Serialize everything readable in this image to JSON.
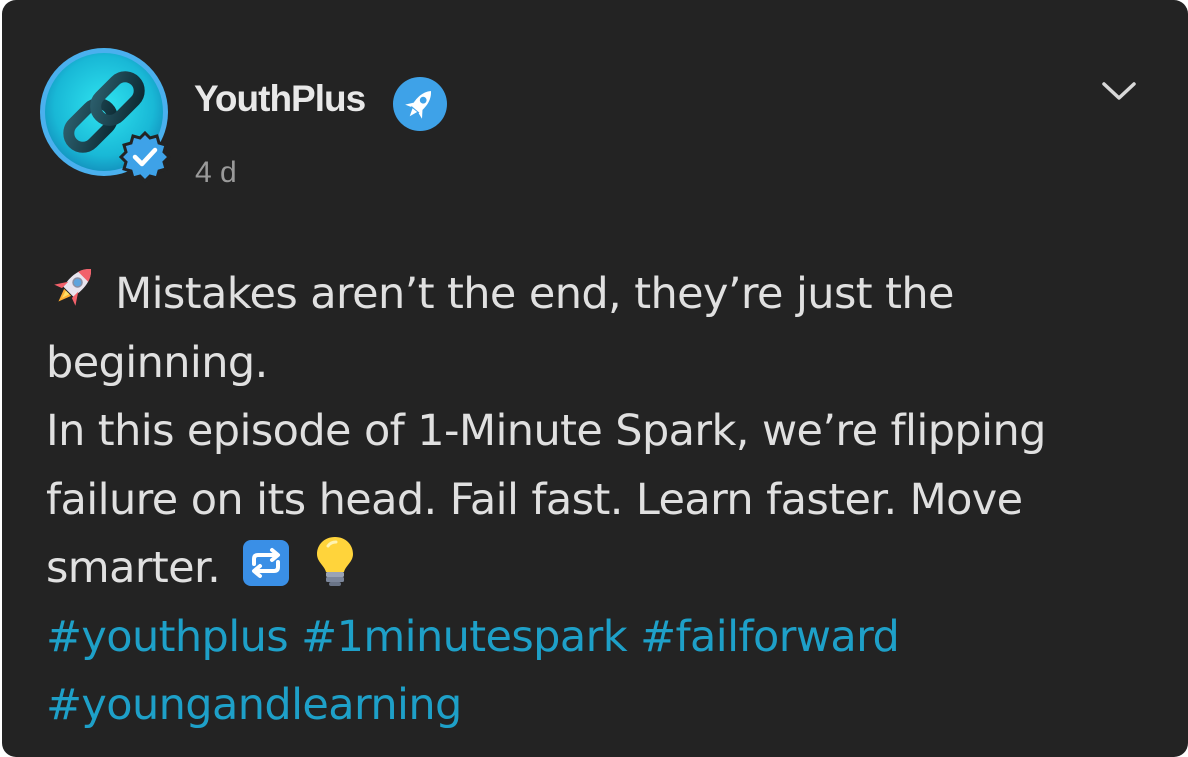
{
  "author": {
    "name": "YouthPlus",
    "timestamp": "4 d",
    "avatar_icon": "chain-link-icon",
    "verified_icon": "verified-check-icon",
    "name_badge_icon": "rocket-badge-icon"
  },
  "menu": {
    "icon": "chevron-down-icon"
  },
  "post": {
    "line1": "Mistakes aren’t the end, they’re just the",
    "line2": "beginning.",
    "line3": "In this episode of 1-Minute Spark, we’re flipping",
    "line4": "failure on its head. Fail fast. Learn faster. Move",
    "line5": "smarter.",
    "emojis": [
      "rocket-emoji",
      "repeat-emoji",
      "lightbulb-emoji"
    ],
    "hashtags": [
      "#youthplus",
      "#1minutespark",
      "#failforward",
      "#youngandlearning"
    ]
  },
  "colors": {
    "background": "#232323",
    "text": "#e0e0e0",
    "hashtag": "#1ea0c8",
    "badge": "#3ea2e8"
  }
}
